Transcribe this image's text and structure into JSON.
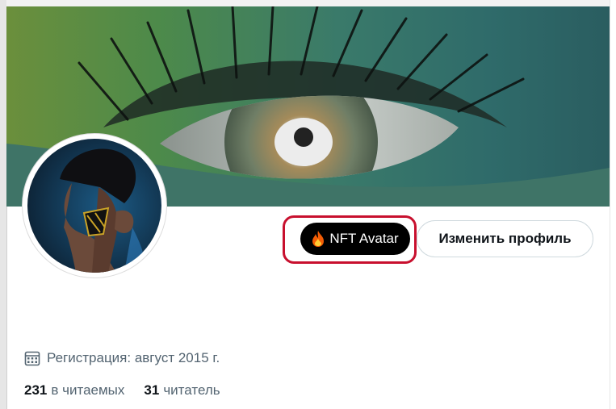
{
  "profile": {
    "nft_badge": {
      "icon": "fire-icon",
      "label": "NFT Avatar"
    },
    "edit_button_label": "Изменить профиль",
    "joined": {
      "icon": "calendar-icon",
      "text": "Регистрация: август 2015 г."
    },
    "following": {
      "count": "231",
      "label": "в читаемых"
    },
    "followers": {
      "count": "31",
      "label": "читатель"
    }
  },
  "colors": {
    "highlight": "#c8102e",
    "nft_button_bg": "#000000",
    "secondary_text": "#536471",
    "primary_text": "#0f1419"
  }
}
